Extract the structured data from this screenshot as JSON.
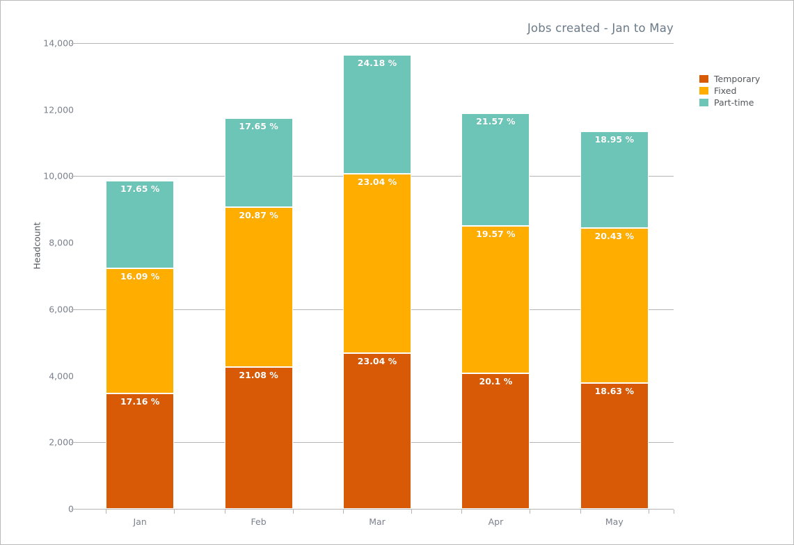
{
  "chart_data": {
    "type": "bar",
    "subtype": "stacked-vertical",
    "title": "Jobs created - Jan to May",
    "xlabel": "",
    "ylabel": "Headcount",
    "categories": [
      "Jan",
      "Feb",
      "Mar",
      "Apr",
      "May"
    ],
    "ylim": [
      0,
      14000
    ],
    "yticks": [
      0,
      2000,
      4000,
      6000,
      8000,
      10000,
      12000,
      14000
    ],
    "ytick_labels": [
      "0",
      "2,000",
      "4,000",
      "6,000",
      "8,000",
      "10,000",
      "12,000",
      "14,000"
    ],
    "grid": true,
    "legend_position": "right",
    "series": [
      {
        "name": "Temporary",
        "color": "#D85A06",
        "values": [
          3470,
          4270,
          4680,
          4080,
          3780
        ],
        "labels": [
          "17.16 %",
          "21.08 %",
          "23.04 %",
          "20.1 %",
          "18.63 %"
        ]
      },
      {
        "name": "Fixed",
        "color": "#FFAE00",
        "values": [
          3760,
          4800,
          5390,
          4420,
          4670
        ],
        "labels": [
          "16.09 %",
          "20.87 %",
          "23.04 %",
          "19.57 %",
          "20.43 %"
        ]
      },
      {
        "name": "Part-time",
        "color": "#6CC5B7",
        "values": [
          2630,
          2680,
          3580,
          3380,
          2900
        ],
        "labels": [
          "17.65 %",
          "17.65 %",
          "24.18 %",
          "21.57 %",
          "18.95 %"
        ]
      }
    ]
  },
  "legend": {
    "items": [
      {
        "label": "Temporary",
        "color": "#D85A06"
      },
      {
        "label": "Fixed",
        "color": "#FFAE00"
      },
      {
        "label": "Part-time",
        "color": "#6CC5B7"
      }
    ]
  }
}
